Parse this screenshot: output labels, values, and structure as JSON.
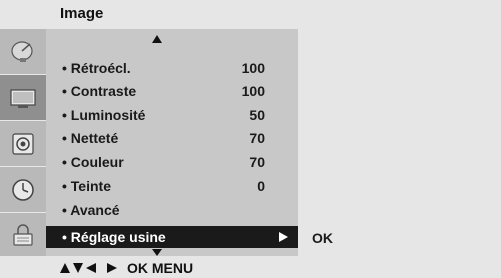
{
  "header": {
    "title": "Image"
  },
  "sidebar": {
    "items": [
      {
        "icon": "satellite-dish-icon"
      },
      {
        "icon": "tv-screen-icon",
        "active": true
      },
      {
        "icon": "speaker-icon"
      },
      {
        "icon": "clock-icon"
      },
      {
        "icon": "lock-icon"
      }
    ]
  },
  "menu": {
    "items": [
      {
        "label": "• Rétroécl.",
        "value": "100"
      },
      {
        "label": "• Contraste",
        "value": "100"
      },
      {
        "label": "• Luminosité",
        "value": "50"
      },
      {
        "label": "• Netteté",
        "value": "70"
      },
      {
        "label": "• Couleur",
        "value": "70"
      },
      {
        "label": "• Teinte",
        "value": "0"
      },
      {
        "label": "• Avancé",
        "value": ""
      },
      {
        "label": "• Réglage usine",
        "value": "",
        "selected": true
      }
    ]
  },
  "submenu": {
    "ok_label": "OK"
  },
  "footer": {
    "nav_text": "OK  MENU"
  },
  "colors": {
    "header_bg": "#e6e6e6",
    "sidebar_bg": "#b9b9b9",
    "menu_bg": "#c8c8c8",
    "selected_bg": "#1a1a1a"
  }
}
